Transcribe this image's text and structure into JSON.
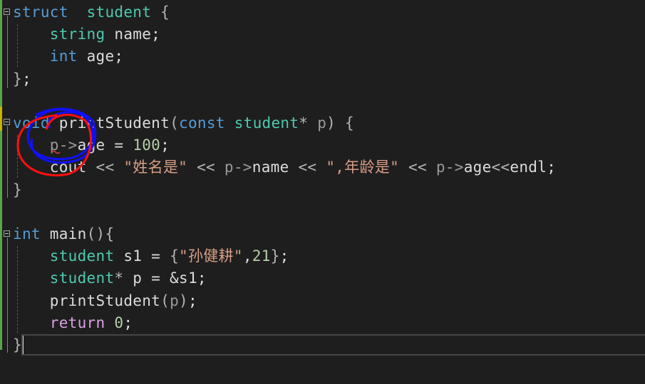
{
  "editor": {
    "lines": [
      {
        "row": 0,
        "tokens": [
          [
            "kw",
            "struct"
          ],
          [
            "",
            "  "
          ],
          [
            "ty",
            "student"
          ],
          [
            "op",
            " {"
          ]
        ]
      },
      {
        "row": 1,
        "tokens": [
          [
            "",
            "    "
          ],
          [
            "ty",
            "string"
          ],
          [
            "",
            " name;"
          ]
        ]
      },
      {
        "row": 2,
        "tokens": [
          [
            "",
            "    "
          ],
          [
            "kw",
            "int"
          ],
          [
            "",
            " age;"
          ]
        ]
      },
      {
        "row": 3,
        "tokens": [
          [
            "op",
            "}"
          ],
          [
            "",
            ";"
          ]
        ]
      },
      {
        "row": 5,
        "tokens": [
          [
            "kw",
            "void"
          ],
          [
            "",
            " "
          ],
          [
            "fn",
            "printStudent"
          ],
          [
            "op",
            "("
          ],
          [
            "kw",
            "const"
          ],
          [
            "",
            " "
          ],
          [
            "ty",
            "student"
          ],
          [
            "op",
            "*"
          ],
          [
            "pm",
            " p"
          ],
          [
            "op",
            ") {"
          ]
        ]
      },
      {
        "row": 6,
        "tokens": [
          [
            "",
            "    "
          ],
          [
            "pm",
            "p->"
          ],
          [
            "",
            "age = "
          ],
          [
            "num",
            "100"
          ],
          [
            "",
            ";"
          ]
        ]
      },
      {
        "row": 7,
        "tokens": [
          [
            "",
            "    "
          ],
          [
            "",
            "cout "
          ],
          [
            "op",
            "<< "
          ],
          [
            "str",
            "\"姓名是\""
          ],
          [
            "op",
            " << "
          ],
          [
            "pm",
            "p->"
          ],
          [
            "",
            "name "
          ],
          [
            "op",
            "<< "
          ],
          [
            "str",
            "\",年龄是\""
          ],
          [
            "op",
            " << "
          ],
          [
            "pm",
            "p->"
          ],
          [
            "",
            "age"
          ],
          [
            "op",
            "<<"
          ],
          [
            "",
            "endl;"
          ]
        ]
      },
      {
        "row": 8,
        "tokens": [
          [
            "op",
            "}"
          ]
        ]
      },
      {
        "row": 10,
        "tokens": [
          [
            "kw",
            "int"
          ],
          [
            "",
            " main"
          ],
          [
            "op",
            "(){"
          ]
        ]
      },
      {
        "row": 11,
        "tokens": [
          [
            "",
            "    "
          ],
          [
            "ty",
            "student"
          ],
          [
            "",
            " s1 = "
          ],
          [
            "op",
            "{"
          ],
          [
            "str",
            "\"孙健耕\""
          ],
          [
            "",
            ","
          ],
          [
            "num",
            "21"
          ],
          [
            "op",
            "}"
          ],
          [
            "",
            ";"
          ]
        ]
      },
      {
        "row": 12,
        "tokens": [
          [
            "",
            "    "
          ],
          [
            "ty",
            "student"
          ],
          [
            "op",
            "*"
          ],
          [
            "",
            " p = &s1;"
          ]
        ]
      },
      {
        "row": 13,
        "tokens": [
          [
            "",
            "    "
          ],
          [
            "fn",
            "printStudent"
          ],
          [
            "op",
            "("
          ],
          [
            "pm",
            "p"
          ],
          [
            "op",
            ")"
          ],
          [
            "",
            ";"
          ]
        ]
      },
      {
        "row": 14,
        "tokens": [
          [
            "",
            "    "
          ],
          [
            "ctl",
            "return"
          ],
          [
            "",
            " "
          ],
          [
            "num",
            "0"
          ],
          [
            "",
            ";"
          ]
        ]
      },
      {
        "row": 15,
        "tokens": [
          [
            "op",
            "}"
          ]
        ]
      }
    ]
  },
  "annotations": {
    "colors": [
      "#ff0000",
      "#0000ff"
    ]
  }
}
